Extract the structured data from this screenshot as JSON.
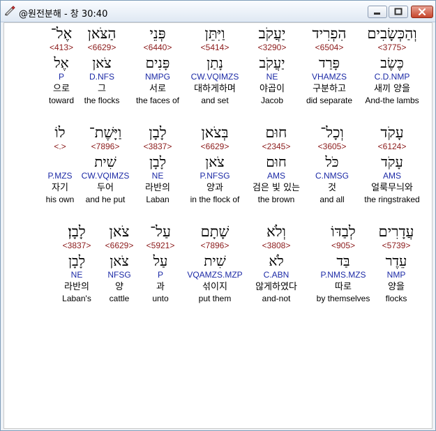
{
  "window": {
    "title": "@원전분해 - 창 30:40"
  },
  "verse_lines": [
    [
      {
        "hebrew": "וְהַכְּשָׂבִים",
        "strong": "<3775>",
        "root": "כֶּשֶׂב",
        "parse": "C.D.NMP",
        "korean": "새끼 양을",
        "english": "And-the lambs",
        "selected": true
      },
      {
        "hebrew": "הִפְרִיד",
        "strong": "<6504>",
        "root": "פָּרַד",
        "parse": "VHAMZS",
        "korean": "구분하고",
        "english": "did separate"
      },
      {
        "hebrew": "יַעֲקֹב",
        "strong": "<3290>",
        "root": "יַעֲקֹב",
        "parse": "NE",
        "korean": "야곱이",
        "english": "Jacob"
      },
      {
        "hebrew": "וַיִּתֵּן",
        "strong": "<5414>",
        "root": "נָתַן",
        "parse": "CW.VQIMZS",
        "korean": "대하게하며",
        "english": "and set"
      },
      {
        "hebrew": "פְּנֵי",
        "strong": "<6440>",
        "root": "פָּנִים",
        "parse": "NMPG",
        "korean": "서로",
        "english": "the faces of"
      },
      {
        "hebrew": "הַצֹּאן",
        "strong": "<6629>",
        "root": "צֹאן",
        "parse": "D.NFS",
        "korean": "그",
        "english": "the flocks"
      },
      {
        "hebrew": "אֶל־",
        "strong": "<413>",
        "root": "אֶל",
        "parse": "P",
        "korean": "으로",
        "english": "toward"
      }
    ],
    [
      {
        "hebrew": "עָקֹד",
        "strong": "<6124>",
        "root": "עָקֹד",
        "parse": "AMS",
        "korean": "얼룩무늬와",
        "english": "the ringstraked"
      },
      {
        "hebrew": "וְכָל־",
        "strong": "<3605>",
        "root": "כֹּל",
        "parse": "C.NMSG",
        "korean": "것",
        "english": "and all"
      },
      {
        "hebrew": "חוּם",
        "strong": "<2345>",
        "root": "חוּם",
        "parse": "AMS",
        "korean": "검은 빛 있는",
        "english": "the brown"
      },
      {
        "hebrew": "בְּצֹאן",
        "strong": "<6629>",
        "root": "צֹאן",
        "parse": "P.NFSG",
        "korean": "양과",
        "english": "in the flock of"
      },
      {
        "hebrew": "לָבָן",
        "strong": "<3837>",
        "root": "לָבָן",
        "parse": "NE",
        "korean": "라반의",
        "english": "Laban"
      },
      {
        "hebrew": "וַיָּשֶׁת־",
        "strong": "<7896>",
        "root": "שִׁית",
        "parse": "CW.VQIMZS",
        "korean": "두어",
        "english": "and he put"
      },
      {
        "hebrew": "לוֹ",
        "strong": "<.>",
        "root": "",
        "parse": "P.MZS",
        "korean": "자기",
        "english": "his own"
      }
    ],
    [
      {
        "hebrew": "עֲדָרִים",
        "strong": "<5739>",
        "root": "עֵדֶר",
        "parse": "NMP",
        "korean": "양을",
        "english": "flocks"
      },
      {
        "hebrew": "לְבַדּוֹ",
        "strong": "<905>",
        "root": "בַּד",
        "parse": "P.NMS.MZS",
        "korean": "따로",
        "english": "by themselves"
      },
      {
        "hebrew": "וְלֹא",
        "strong": "<3808>",
        "root": "לֹא",
        "parse": "C.ABN",
        "korean": "않게하였다",
        "english": "and-not"
      },
      {
        "hebrew": "שָׁתָם",
        "strong": "<7896>",
        "root": "שִׁית",
        "parse": "VQAMZS.MZP",
        "korean": "섞이지",
        "english": "put them"
      },
      {
        "hebrew": "עַל־",
        "strong": "<5921>",
        "root": "עַל",
        "parse": "P",
        "korean": "과",
        "english": "unto"
      },
      {
        "hebrew": "צֹאן",
        "strong": "<6629>",
        "root": "צֹאן",
        "parse": "NFSG",
        "korean": "양",
        "english": "cattle"
      },
      {
        "hebrew": "לָבָן׃",
        "strong": "<3837>",
        "root": "לָבָן",
        "parse": "NE",
        "korean": "라반의",
        "english": "Laban's"
      }
    ]
  ]
}
